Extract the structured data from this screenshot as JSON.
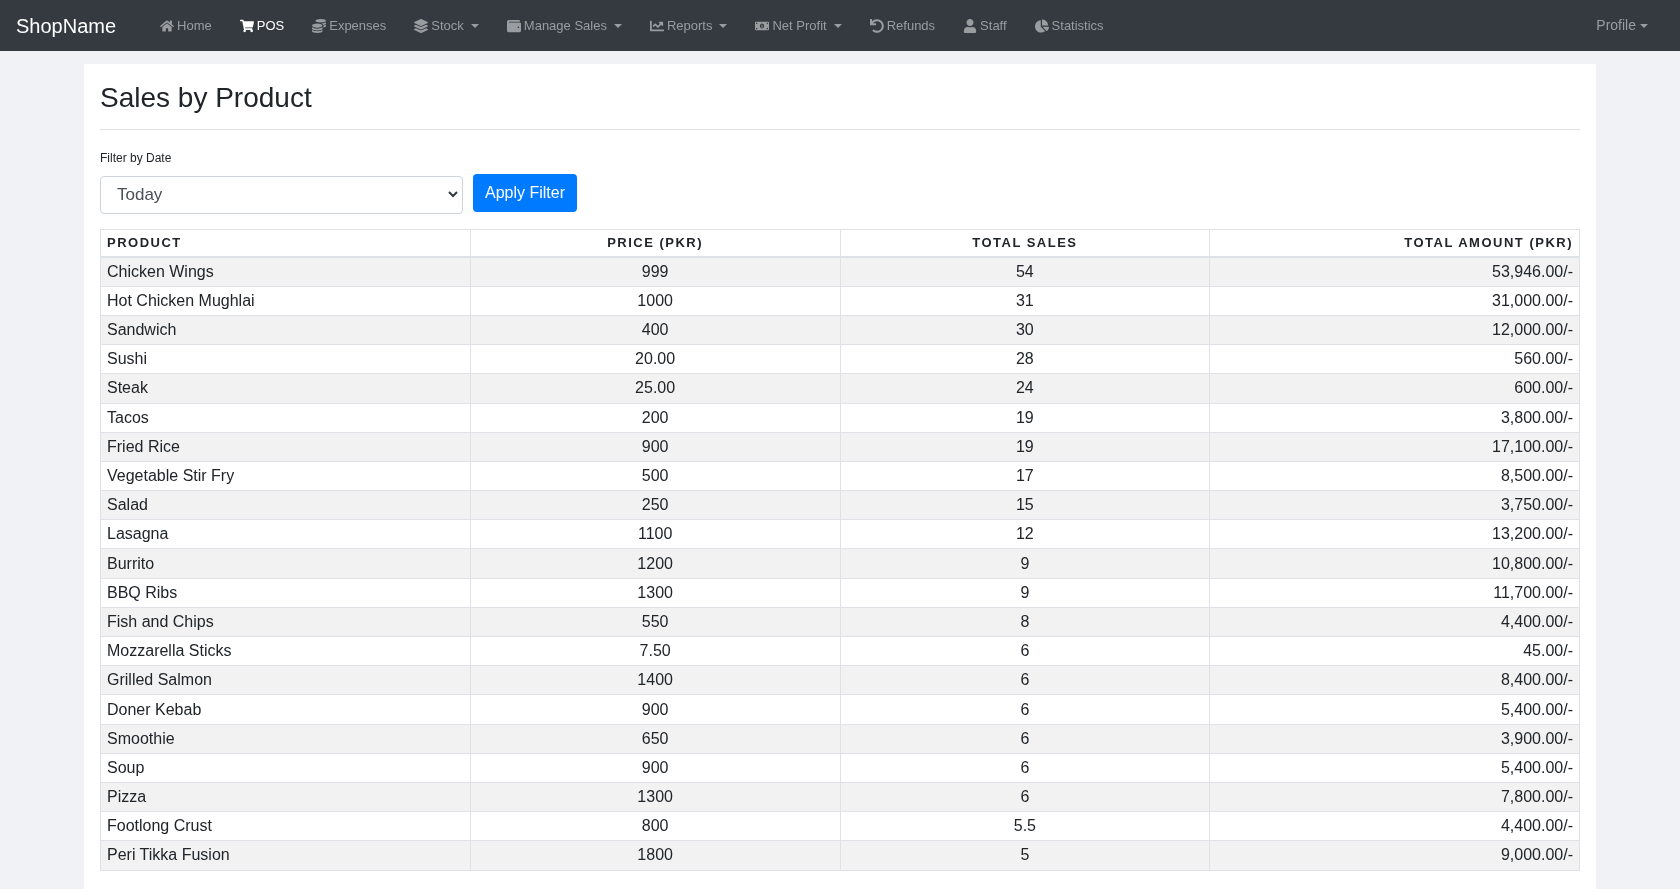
{
  "brand": "ShopName",
  "nav": [
    {
      "label": "Home",
      "dropdown": false,
      "selected": false
    },
    {
      "label": "POS",
      "dropdown": false,
      "selected": true
    },
    {
      "label": "Expenses",
      "dropdown": false,
      "selected": false
    },
    {
      "label": "Stock",
      "dropdown": true,
      "selected": false
    },
    {
      "label": "Manage Sales",
      "dropdown": true,
      "selected": false
    },
    {
      "label": "Reports",
      "dropdown": true,
      "selected": false
    },
    {
      "label": "Net Profit",
      "dropdown": true,
      "selected": false
    },
    {
      "label": "Refunds",
      "dropdown": false,
      "selected": false
    },
    {
      "label": "Staff",
      "dropdown": false,
      "selected": false
    },
    {
      "label": "Statistics",
      "dropdown": false,
      "selected": false
    }
  ],
  "profile": {
    "label": "Profile",
    "dropdown": true
  },
  "title": "Sales by Product",
  "filter": {
    "label": "Filter by Date",
    "value": "Today",
    "button": "Apply Filter"
  },
  "table": {
    "columns": [
      "PRODUCT",
      "PRICE (PKR)",
      "TOTAL SALES",
      "TOTAL AMOUNT (PKR)"
    ],
    "rows": [
      [
        "Chicken Wings",
        "999",
        "54",
        "53,946.00/-"
      ],
      [
        "Hot Chicken Mughlai",
        "1000",
        "31",
        "31,000.00/-"
      ],
      [
        "Sandwich",
        "400",
        "30",
        "12,000.00/-"
      ],
      [
        "Sushi",
        "20.00",
        "28",
        "560.00/-"
      ],
      [
        "Steak",
        "25.00",
        "24",
        "600.00/-"
      ],
      [
        "Tacos",
        "200",
        "19",
        "3,800.00/-"
      ],
      [
        "Fried Rice",
        "900",
        "19",
        "17,100.00/-"
      ],
      [
        "Vegetable Stir Fry",
        "500",
        "17",
        "8,500.00/-"
      ],
      [
        "Salad",
        "250",
        "15",
        "3,750.00/-"
      ],
      [
        "Lasagna",
        "1100",
        "12",
        "13,200.00/-"
      ],
      [
        "Burrito",
        "1200",
        "9",
        "10,800.00/-"
      ],
      [
        "BBQ Ribs",
        "1300",
        "9",
        "11,700.00/-"
      ],
      [
        "Fish and Chips",
        "550",
        "8",
        "4,400.00/-"
      ],
      [
        "Mozzarella Sticks",
        "7.50",
        "6",
        "45.00/-"
      ],
      [
        "Grilled Salmon",
        "1400",
        "6",
        "8,400.00/-"
      ],
      [
        "Doner Kebab",
        "900",
        "6",
        "5,400.00/-"
      ],
      [
        "Smoothie",
        "650",
        "6",
        "3,900.00/-"
      ],
      [
        "Soup",
        "900",
        "6",
        "5,400.00/-"
      ],
      [
        "Pizza",
        "1300",
        "6",
        "7,800.00/-"
      ],
      [
        "Footlong Crust",
        "800",
        "5.5",
        "4,400.00/-"
      ],
      [
        "Peri Tikka Fusion",
        "1800",
        "5",
        "9,000.00/-"
      ]
    ]
  }
}
